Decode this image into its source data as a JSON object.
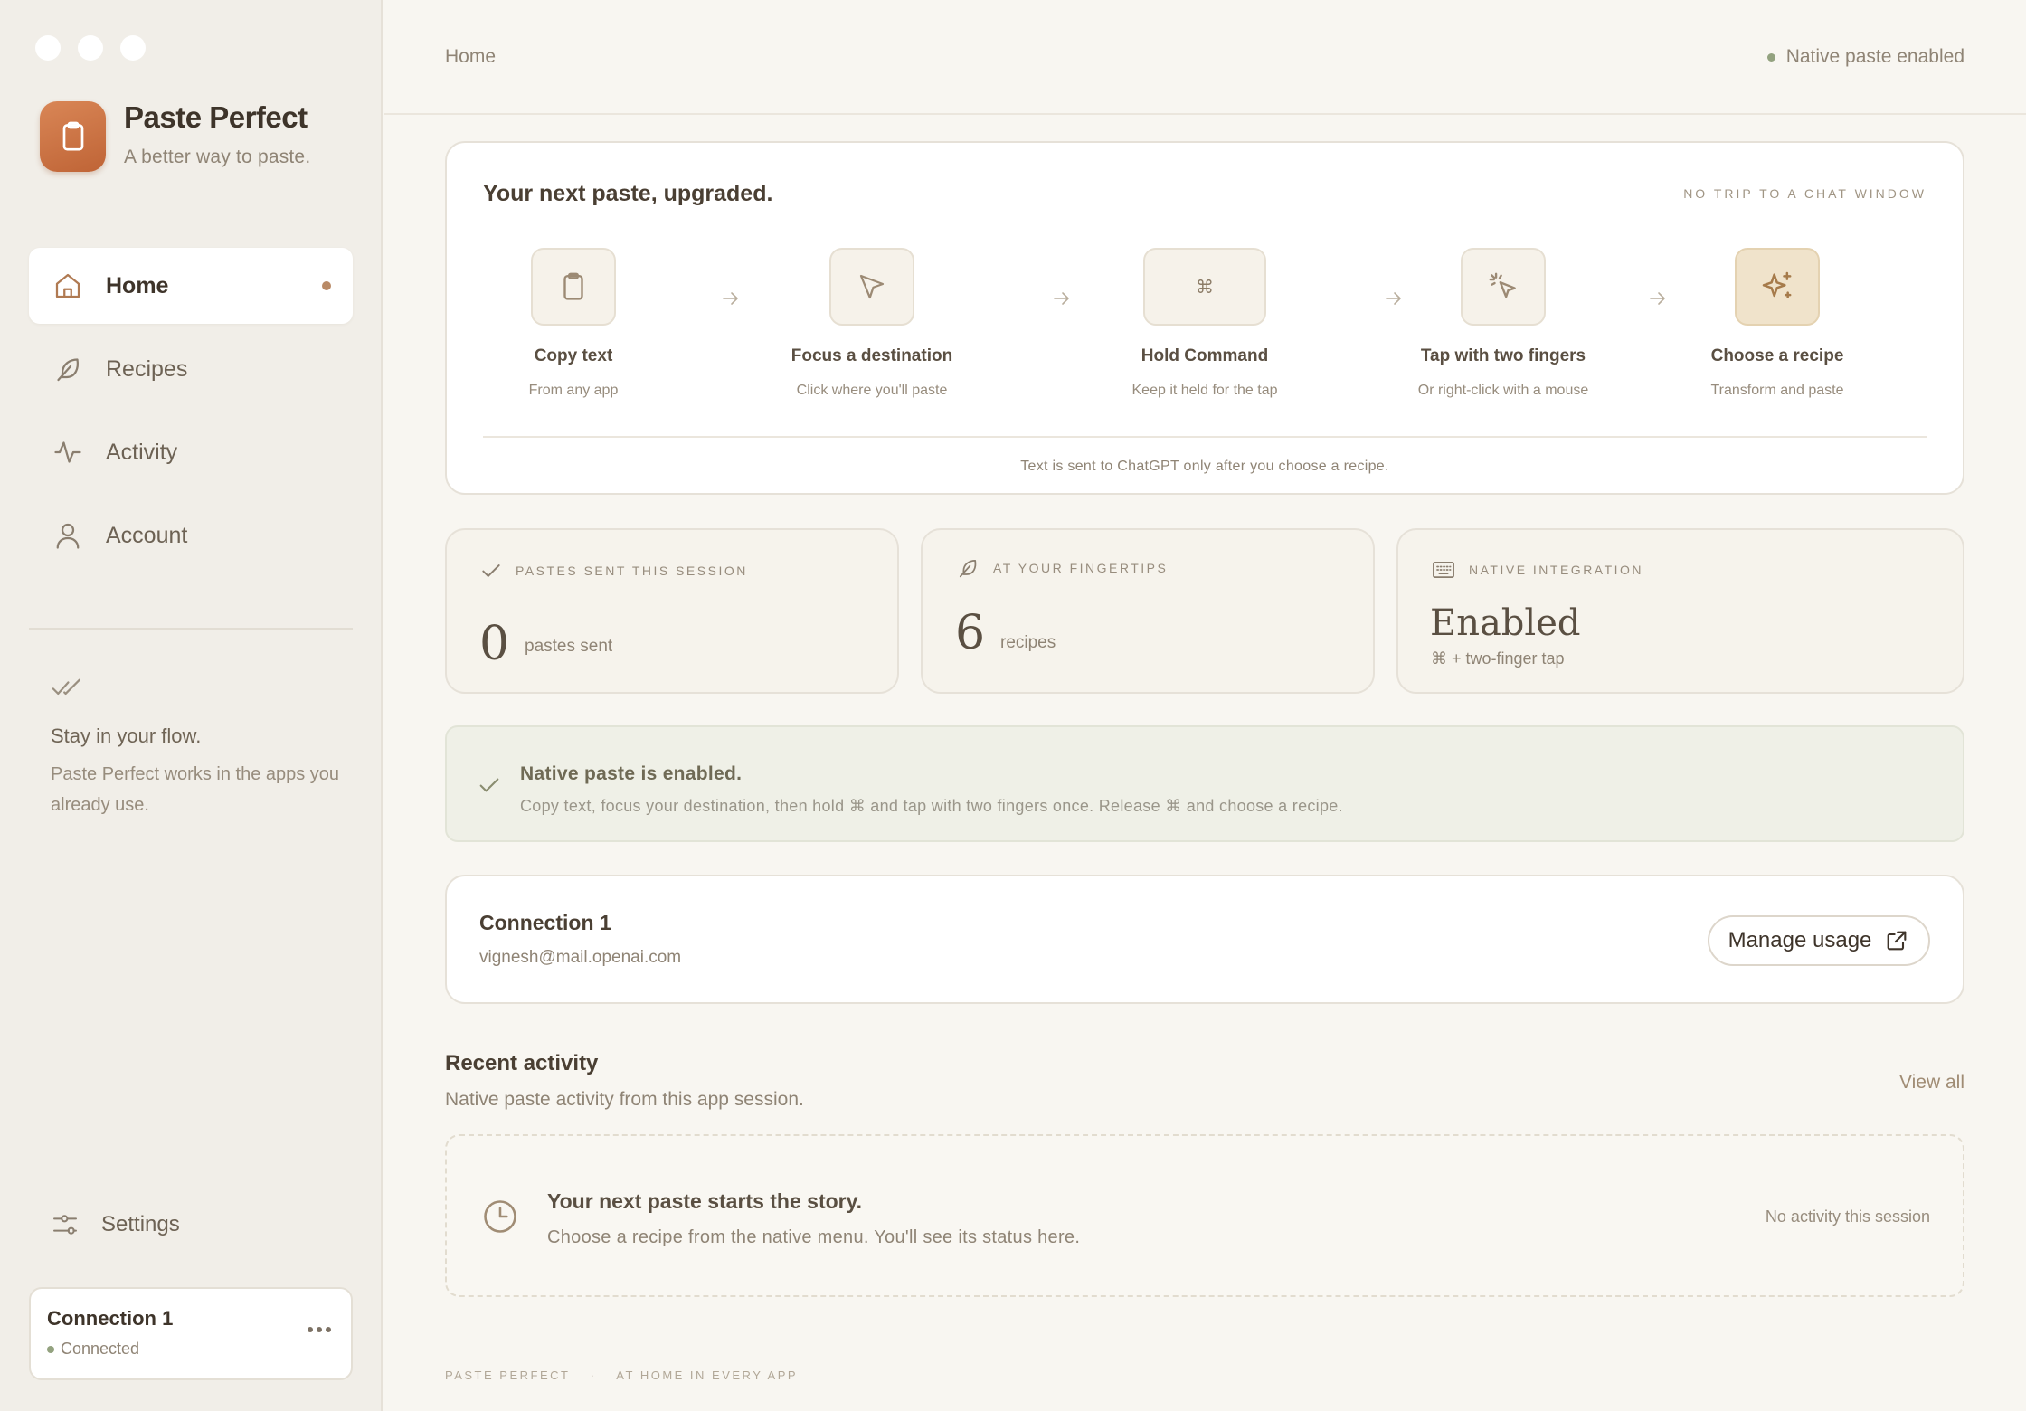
{
  "app": {
    "name": "Paste Perfect",
    "tagline": "A better way to paste."
  },
  "sidebar": {
    "items": [
      {
        "label": "Home",
        "icon": "home-icon",
        "active": true
      },
      {
        "label": "Recipes",
        "icon": "feather-icon"
      },
      {
        "label": "Activity",
        "icon": "activity-icon"
      },
      {
        "label": "Account",
        "icon": "user-icon"
      }
    ],
    "flow": {
      "title": "Stay in your flow.",
      "text": "Paste Perfect works in the apps you already use."
    },
    "settings_label": "Settings",
    "connection": {
      "name": "Connection 1",
      "status": "Connected"
    }
  },
  "header": {
    "breadcrumb": "Home",
    "status": "Native paste enabled"
  },
  "hero": {
    "title": "Your next paste, upgraded.",
    "tag": "NO TRIP TO A CHAT WINDOW",
    "steps": [
      {
        "title": "Copy text",
        "sub": "From any app",
        "icon": "clipboard-icon"
      },
      {
        "title": "Focus a destination",
        "sub": "Click where you'll paste",
        "icon": "cursor-icon"
      },
      {
        "title": "Hold Command",
        "sub": "Keep it held for the tap",
        "icon": "command-key-icon",
        "glyph": "⌘"
      },
      {
        "title": "Tap with two fingers",
        "sub": "Or right-click with a mouse",
        "icon": "tap-cursor-icon"
      },
      {
        "title": "Choose a recipe",
        "sub": "Transform and paste",
        "icon": "sparkles-icon"
      }
    ],
    "footnote": "Text is sent to ChatGPT only after you choose a recipe."
  },
  "stats": [
    {
      "label": "PASTES SENT THIS SESSION",
      "value": "0",
      "unit": "pastes sent",
      "icon": "check-icon"
    },
    {
      "label": "AT YOUR FINGERTIPS",
      "value": "6",
      "unit": "recipes",
      "icon": "feather-icon"
    },
    {
      "label": "NATIVE INTEGRATION",
      "value": "Enabled",
      "hint": "⌘ + two-finger tap",
      "icon": "keyboard-icon"
    }
  ],
  "notice": {
    "title": "Native paste is enabled.",
    "text": "Copy text, focus your destination, then hold ⌘ and tap with two fingers once. Release ⌘ and choose a recipe."
  },
  "connection": {
    "title": "Connection 1",
    "email": "vignesh@mail.openai.com",
    "manage_label": "Manage usage"
  },
  "recent": {
    "title": "Recent activity",
    "subtitle": "Native paste activity from this app session.",
    "view_all": "View all",
    "empty_title": "Your next paste starts the story.",
    "empty_text": "Choose a recipe from the native menu. You'll see its status here.",
    "empty_note": "No activity this session"
  },
  "footer": {
    "left": "PASTE PERFECT",
    "sep": "·",
    "right": "AT HOME IN EVERY APP"
  },
  "colors": {
    "accent": "#c7713f",
    "sidebar_bg": "#f1eee8",
    "main_bg": "#f8f6f1",
    "success": "#93a27f"
  }
}
